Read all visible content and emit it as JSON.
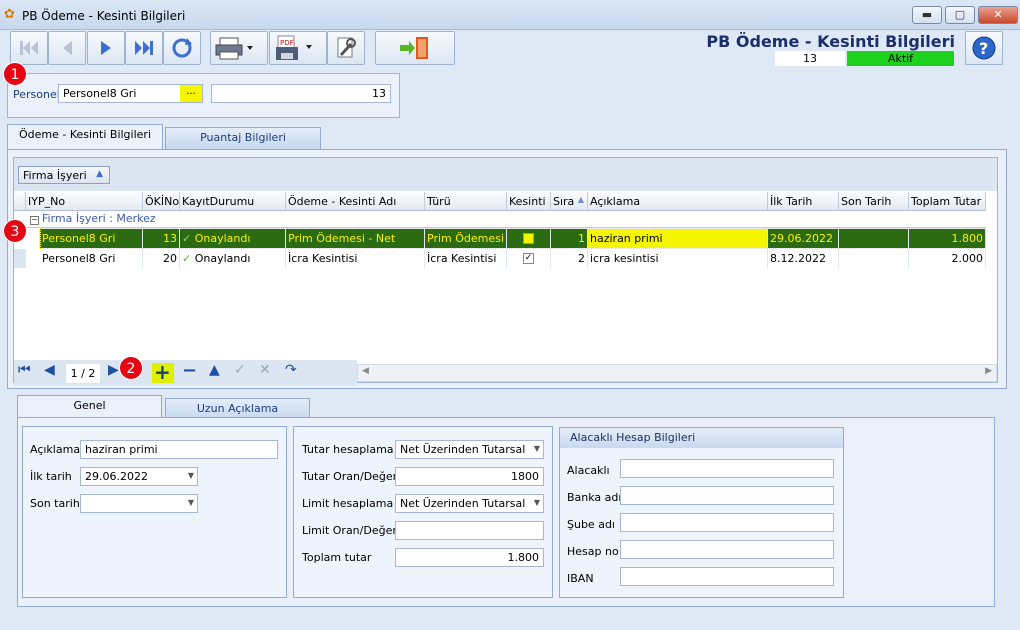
{
  "window": {
    "title": "PB Ödeme - Kesinti Bilgileri",
    "min": "▬",
    "max": "▢",
    "close": "✕"
  },
  "header": {
    "form_title": "PB Ödeme - Kesinti Bilgileri",
    "record_no": "13",
    "status": "Aktif",
    "status_color": "#1fd11f"
  },
  "personel": {
    "label": "Personel",
    "name": "Personel8 Gri",
    "browse": "...",
    "id": "13"
  },
  "tabs_top": [
    {
      "label": "Ödeme - Kesinti Bilgileri"
    },
    {
      "label": "Puantaj Bilgileri"
    }
  ],
  "grid": {
    "group_by": "Firma İşyeri",
    "group_row": "Firma İşyeri : Merkez",
    "columns": [
      "IYP_No",
      "ÖKİNo",
      "KayıtDurumu",
      "Ödeme - Kesinti Adı",
      "Türü",
      "Kesinti",
      "Sıra",
      "Açıklama",
      "İlk Tarih",
      "Son Tarih",
      "Toplam Tutar"
    ],
    "rows": [
      {
        "iyp": "Personel8 Gri",
        "oki": "13",
        "durum": "Onaylandı",
        "ad": "Prim Ödemesi - Net",
        "tur": "Prim Ödemesi",
        "kesinti": "",
        "sira": "1",
        "aciklama": "haziran primi",
        "ilk": "29.06.2022",
        "son": "",
        "tutar": "1.800"
      },
      {
        "iyp": "Personel8 Gri",
        "oki": "20",
        "durum": "Onaylandı",
        "ad": "İcra Kesintisi",
        "tur": "İcra Kesintisi",
        "kesinti": "✓",
        "sira": "2",
        "aciklama": "icra kesintisi",
        "ilk": "8.12.2022",
        "son": "",
        "tutar": "2.000"
      }
    ],
    "checkmark": "✓",
    "pager": "1 / 2"
  },
  "badges": {
    "b1": "1",
    "b2": "2",
    "b3": "3"
  },
  "tabs_bottom": [
    {
      "label": "Genel"
    },
    {
      "label": "Uzun Açıklama"
    }
  ],
  "genel": {
    "aciklama_label": "Açıklama",
    "aciklama": "haziran primi",
    "ilk_label": "İlk tarih",
    "ilk": "29.06.2022",
    "son_label": "Son tarih",
    "son": ""
  },
  "tutar": {
    "hesaplama_label": "Tutar hesaplama",
    "hesaplama": "Net Üzerinden Tutarsal",
    "oran_label": "Tutar Oran/Değer",
    "oran": "1800",
    "limit_label": "Limit hesaplama",
    "limit": "Net Üzerinden Tutarsal",
    "limit_oran_label": "Limit Oran/Değer",
    "limit_oran": "",
    "toplam_label": "Toplam tutar",
    "toplam": "1.800"
  },
  "alacakli": {
    "title": "Alacaklı Hesap Bilgileri",
    "alacakli_label": "Alacaklı",
    "banka_label": "Banka adı",
    "sube_label": "Şube adı",
    "hesap_label": "Hesap no",
    "iban_label": "IBAN"
  }
}
